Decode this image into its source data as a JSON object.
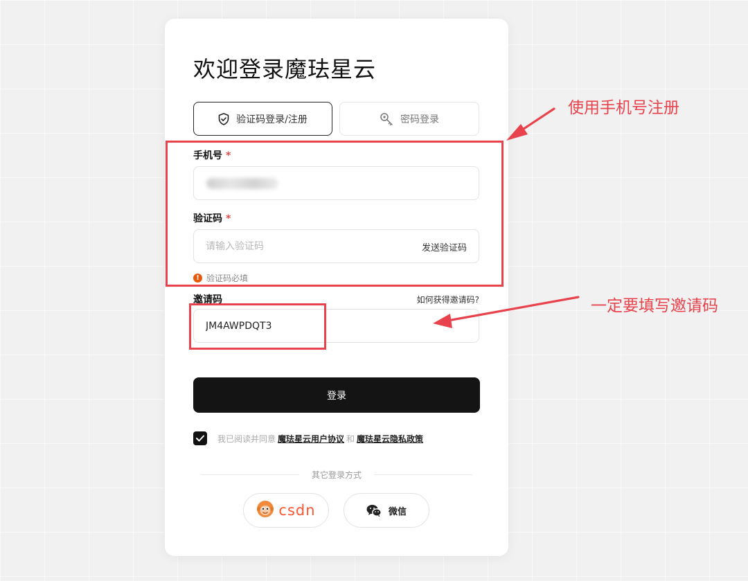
{
  "title": "欢迎登录魔珐星云",
  "tabs": {
    "code_login": "验证码登录/注册",
    "password_login": "密码登录"
  },
  "phone": {
    "label": "手机号",
    "required_mark": "*"
  },
  "code": {
    "label": "验证码",
    "required_mark": "*",
    "placeholder": "请输入验证码",
    "send_label": "发送验证码",
    "error": "验证码必填",
    "error_icon": "!"
  },
  "invite": {
    "label": "邀请码",
    "help": "如何获得邀请码?",
    "value": "JM4AWPDQT3"
  },
  "login_button": "登录",
  "agreement": {
    "prefix": "我已阅读并同意",
    "terms": "魔珐星云用户协议",
    "and": "和",
    "privacy": "魔珐星云隐私政策"
  },
  "other_login": "其它登录方式",
  "social": {
    "csdn": "csdn",
    "wechat": "微信"
  },
  "annotations": {
    "register_note": "使用手机号注册",
    "invite_note": "一定要填写邀请码",
    "color": "#e8434d"
  },
  "colors": {
    "primary": "#141414",
    "error": "#e8590c",
    "required": "#e5484d",
    "csdn": "#fc5531"
  }
}
